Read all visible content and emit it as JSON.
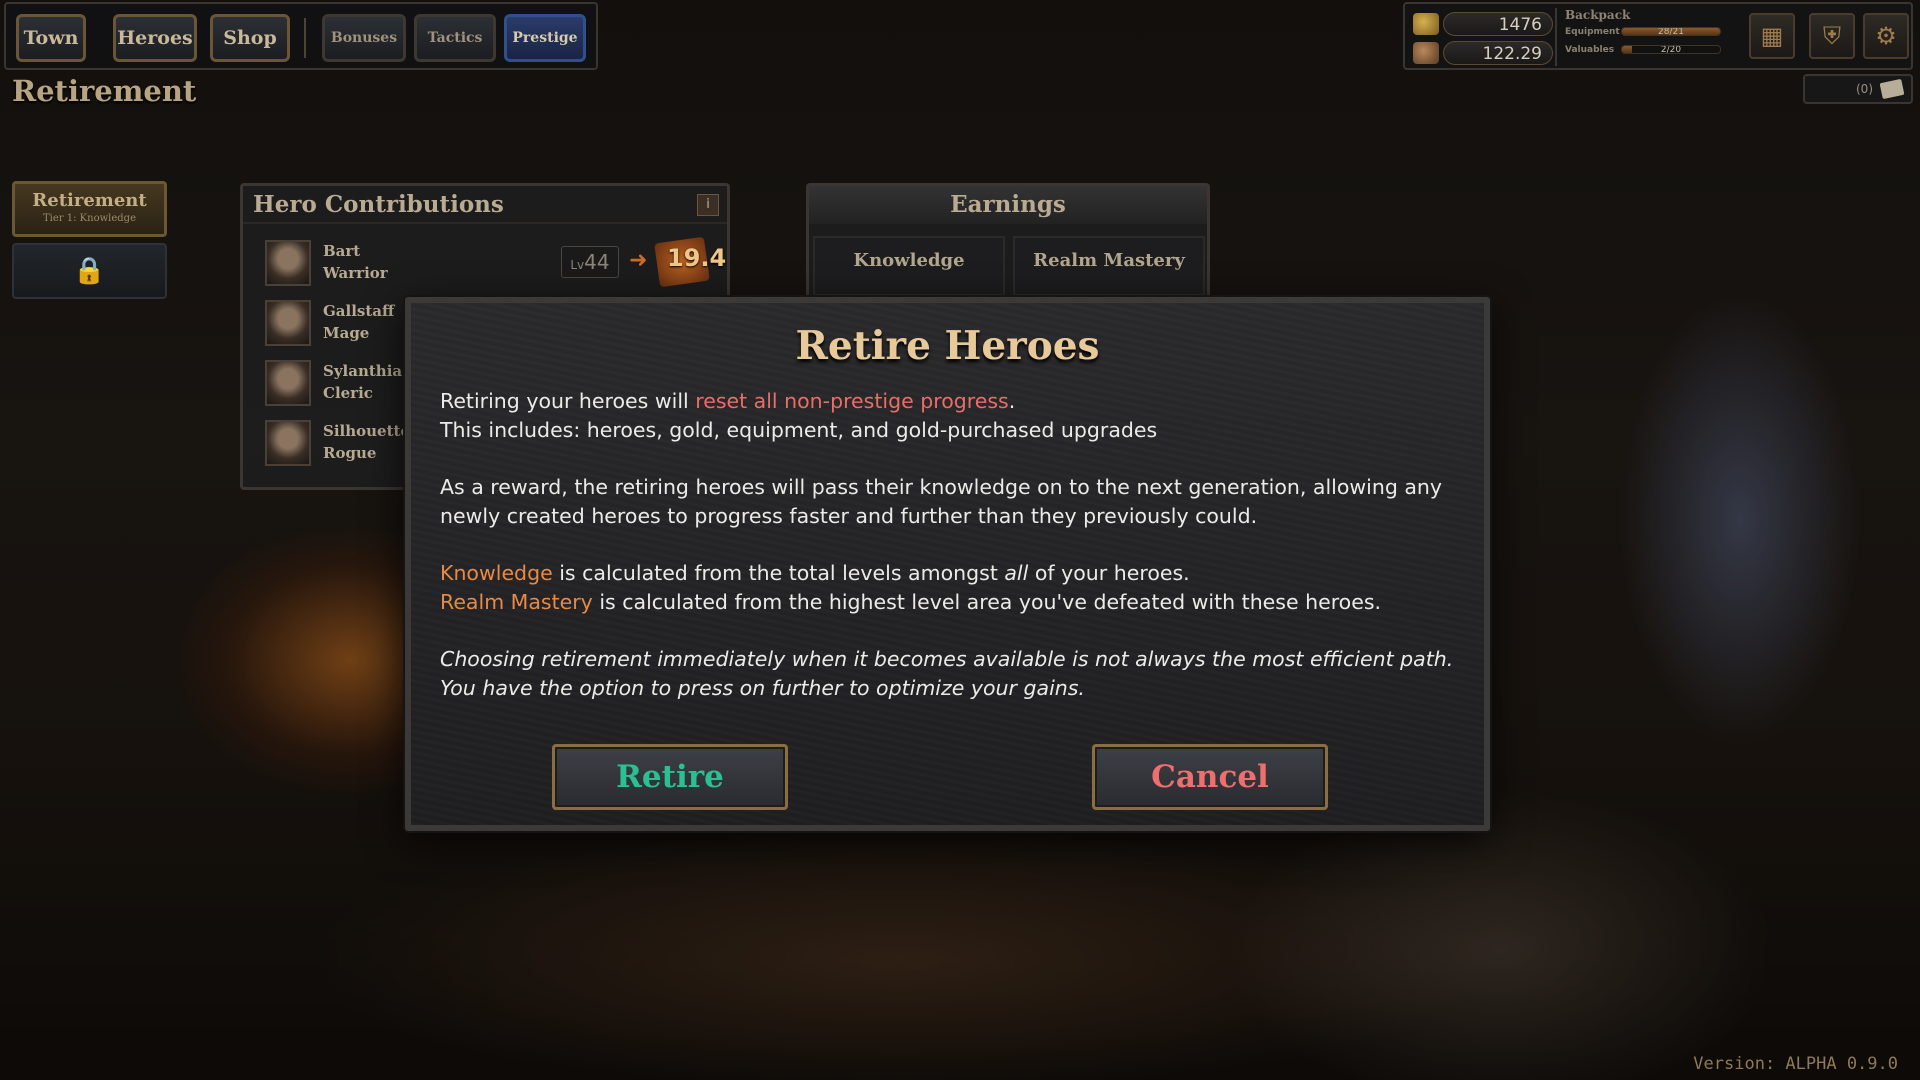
{
  "nav": {
    "main": [
      "Town",
      "Heroes",
      "Shop"
    ],
    "sub": [
      "Bonuses",
      "Tactics",
      "Prestige"
    ]
  },
  "page_title": "Retirement",
  "resources": {
    "gold": "1476",
    "secondary": "122.29"
  },
  "backpack": {
    "title": "Backpack",
    "equipment_label": "Equipment",
    "equipment_value": "28/21",
    "equipment_fill": 1.0,
    "valuables_label": "Valuables",
    "valuables_value": "2/20",
    "valuables_fill": 0.1
  },
  "icons": [
    "map-icon",
    "shield-icon",
    "gear-icon"
  ],
  "mail_count": "(0)",
  "sidebar": {
    "tier_title": "Retirement",
    "tier_subtitle": "Tier 1: Knowledge"
  },
  "hero_contributions": {
    "title": "Hero Contributions",
    "info": "i",
    "heroes": [
      {
        "name": "Bart",
        "class": "Warrior",
        "level_prefix": "Lv",
        "level": "44",
        "knowledge": "19.4"
      },
      {
        "name": "Gallstaff",
        "class": "Mage"
      },
      {
        "name": "Sylanthia",
        "class": "Cleric"
      },
      {
        "name": "Silhouette",
        "class": "Rogue"
      }
    ]
  },
  "earnings": {
    "title": "Earnings",
    "col1": "Knowledge",
    "col2": "Realm Mastery"
  },
  "modal": {
    "title": "Retire Heroes",
    "p1_a": "Retiring your heroes will ",
    "p1_highlight": "reset all non-prestige progress",
    "p1_b": ".",
    "p1_line2": "This includes: heroes, gold, equipment, and gold-purchased upgrades",
    "p2": "As a reward, the retiring heroes will pass their knowledge on to the next generation, allowing any newly created heroes to progress faster and further than they previously could.",
    "p3_knowledge": "Knowledge",
    "p3_a": " is calculated from the total levels amongst ",
    "p3_all": "all",
    "p3_b": " of your heroes.",
    "p3_realm": "Realm Mastery",
    "p3_c": " is calculated from the highest level area you've defeated with these heroes.",
    "p4": "Choosing retirement immediately when it becomes available is not always the most efficient path. You have the option to press on further to optimize your gains.",
    "retire_label": "Retire",
    "cancel_label": "Cancel"
  },
  "colors": {
    "retire": "#2bbf94",
    "cancel": "#ef6e6e",
    "highlight_red": "#e86e66",
    "highlight_orange": "#e88945",
    "title_gold": "#e7c99a"
  },
  "version": "Version: ALPHA 0.9.0"
}
